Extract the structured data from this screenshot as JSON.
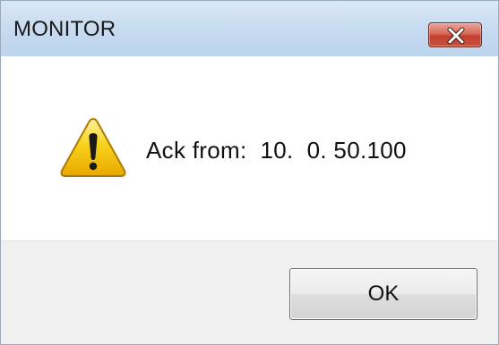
{
  "window": {
    "title": "MONITOR"
  },
  "message": {
    "text": "Ack from:  10.  0. 50.100",
    "icon": "warning-icon"
  },
  "buttons": {
    "ok_label": "OK",
    "close_icon": "close-icon"
  },
  "colors": {
    "titlebar": "#c9dcf1",
    "close_button": "#c7513f",
    "footer": "#f0f0f0",
    "warning_yellow": "#f5c400"
  }
}
